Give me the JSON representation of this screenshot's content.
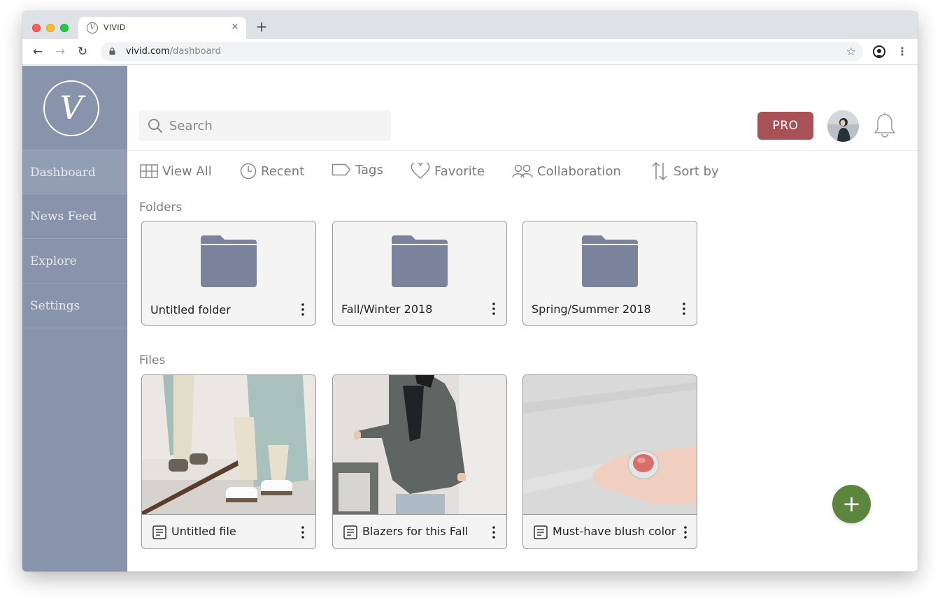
{
  "browser": {
    "tab_title": "VIVID",
    "tab_favicon": "V",
    "tab_close": "×",
    "new_tab": "+",
    "url_host": "vivid.com",
    "url_path": "/dashboard",
    "back": "←",
    "forward": "→",
    "reload": "↻",
    "bookmark": "☆",
    "menu": "⋮"
  },
  "sidebar": {
    "logo": "V",
    "items": [
      {
        "label": "Dashboard"
      },
      {
        "label": "News Feed"
      },
      {
        "label": "Explore"
      },
      {
        "label": "Settings"
      }
    ]
  },
  "header": {
    "search_placeholder": "Search",
    "pro_label": "PRO"
  },
  "filters": [
    {
      "label": "View All",
      "icon": "grid-icon"
    },
    {
      "label": "Recent",
      "icon": "clock-icon"
    },
    {
      "label": "Tags",
      "icon": "tag-icon"
    },
    {
      "label": "Favorite",
      "icon": "heart-icon"
    },
    {
      "label": "Collaboration",
      "icon": "people-icon"
    },
    {
      "label": "Sort by",
      "icon": "sort-icon"
    }
  ],
  "folders": {
    "title": "Folders",
    "items": [
      {
        "name": "Untitled folder"
      },
      {
        "name": "Fall/Winter 2018"
      },
      {
        "name": "Spring/Summer 2018"
      }
    ]
  },
  "files": {
    "title": "Files",
    "items": [
      {
        "name": "Untitled file"
      },
      {
        "name": "Blazers for this Fall"
      },
      {
        "name": "Must-have blush color"
      }
    ]
  },
  "fab": {
    "label": "+"
  },
  "colors": {
    "sidebar": "#8794ab",
    "pro": "#a85156",
    "fab": "#5c853d",
    "folder": "#7a839b"
  }
}
